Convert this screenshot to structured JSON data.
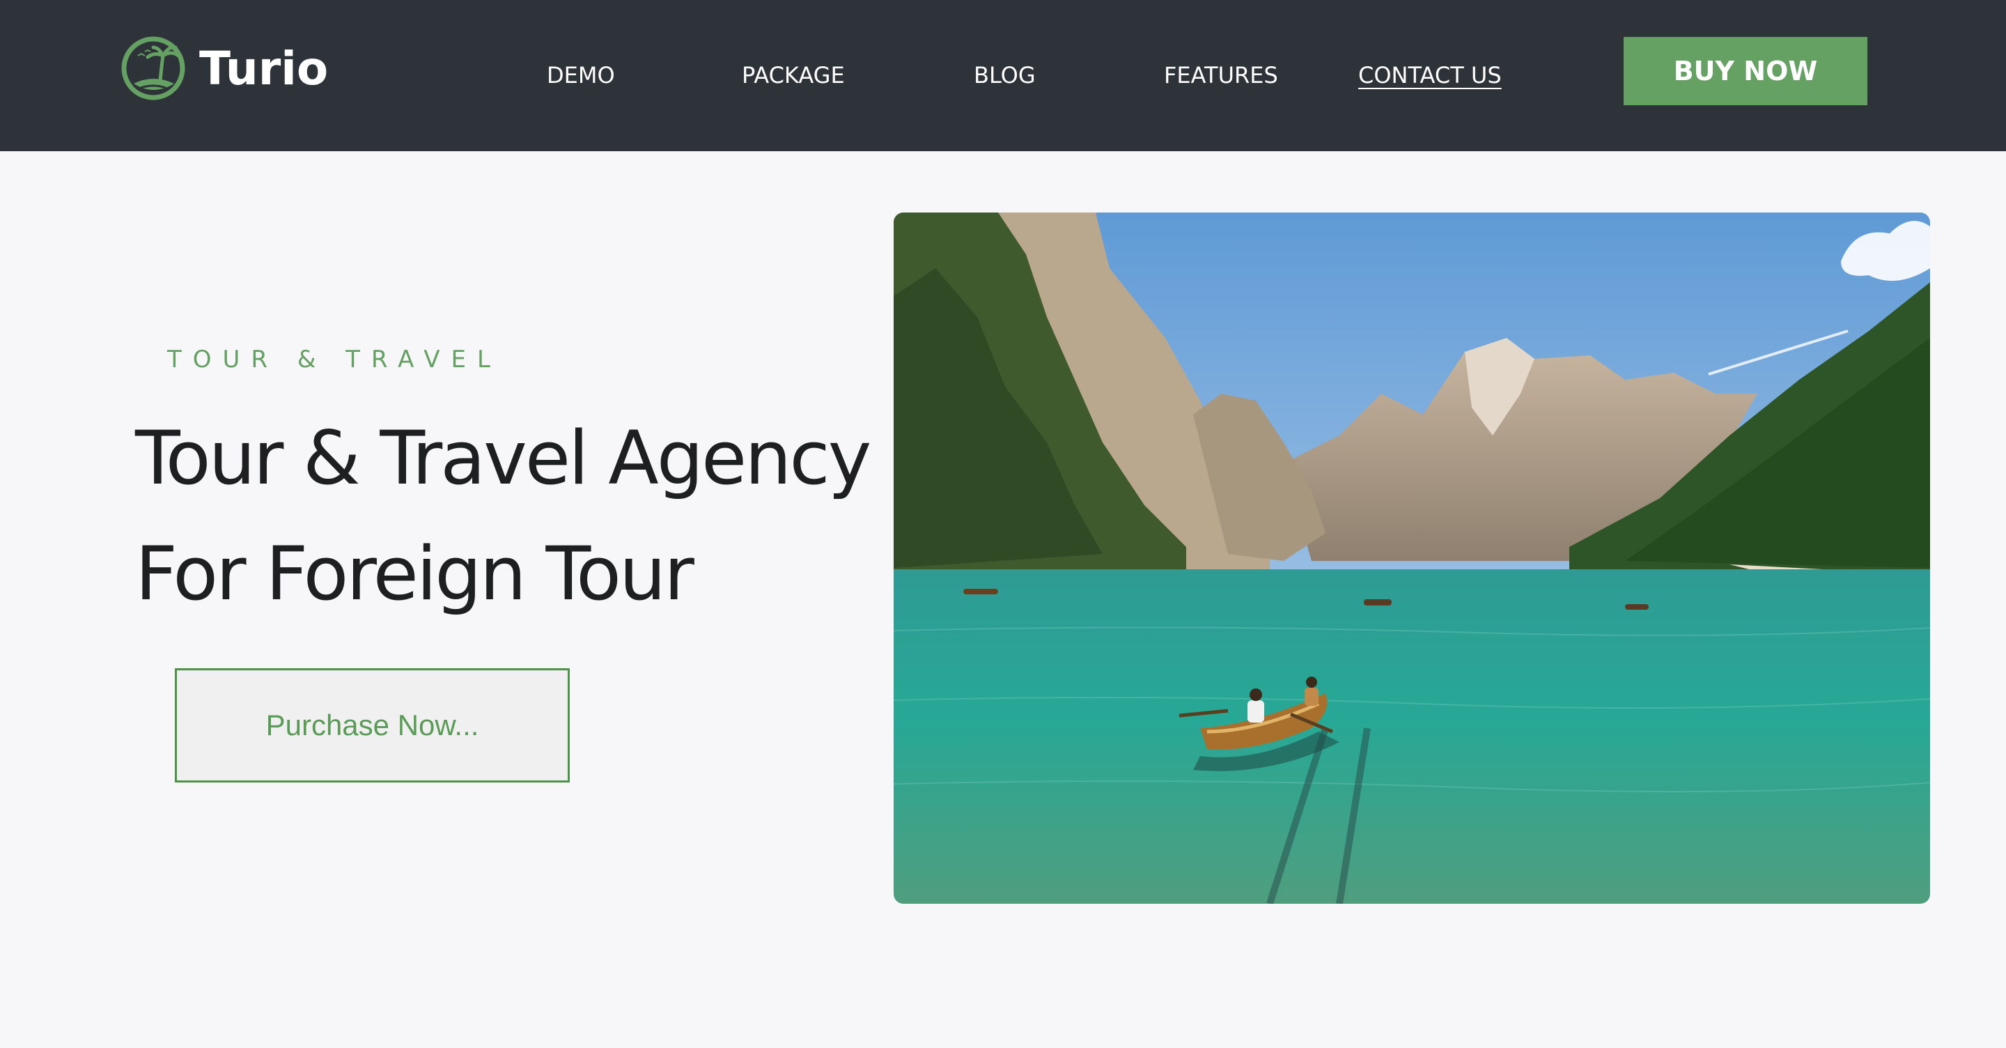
{
  "brand": {
    "name": "Turio",
    "logo_icon": "palm-island-icon"
  },
  "nav": {
    "items": [
      {
        "label": "DEMO",
        "active": false
      },
      {
        "label": "PACKAGE",
        "active": false
      },
      {
        "label": "BLOG",
        "active": false
      },
      {
        "label": "FEATURES",
        "active": false
      },
      {
        "label": "CONTACT US",
        "active": true
      }
    ],
    "cta_label": "BUY NOW"
  },
  "hero": {
    "eyebrow": "TOUR & TRAVEL",
    "headline_line1": "Tour & Travel Agency",
    "headline_line2": "For Foreign Tour",
    "button_label": "Purchase Now...",
    "image": "mountain-lake-rowboat-photo"
  },
  "colors": {
    "header_bg": "#2d3338",
    "accent": "#65a163",
    "page_bg": "#f7f7fa",
    "headline": "#1d1f21"
  }
}
